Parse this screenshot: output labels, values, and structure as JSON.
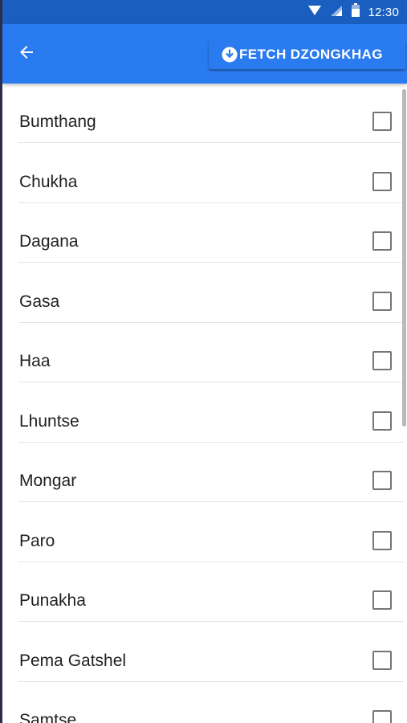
{
  "status_bar": {
    "time": "12:30",
    "icons": [
      "wifi-icon",
      "signal-icon",
      "battery-icon"
    ]
  },
  "app_bar": {
    "back_icon": "arrow-left-icon",
    "fetch_button": {
      "icon": "download-circle-icon",
      "label": "FETCH DZONGKHAG"
    }
  },
  "dzongkhags": [
    {
      "name": "Bumthang",
      "checked": false
    },
    {
      "name": "Chukha",
      "checked": false
    },
    {
      "name": "Dagana",
      "checked": false
    },
    {
      "name": "Gasa",
      "checked": false
    },
    {
      "name": "Haa",
      "checked": false
    },
    {
      "name": "Lhuntse",
      "checked": false
    },
    {
      "name": "Mongar",
      "checked": false
    },
    {
      "name": "Paro",
      "checked": false
    },
    {
      "name": "Punakha",
      "checked": false
    },
    {
      "name": "Pema Gatshel",
      "checked": false
    },
    {
      "name": "Samtse",
      "checked": false
    }
  ],
  "colors": {
    "status_bar": "#1a5fc0",
    "app_bar": "#2b7bf0",
    "checkbox_border": "#757575",
    "divider": "#e4e4e4"
  }
}
